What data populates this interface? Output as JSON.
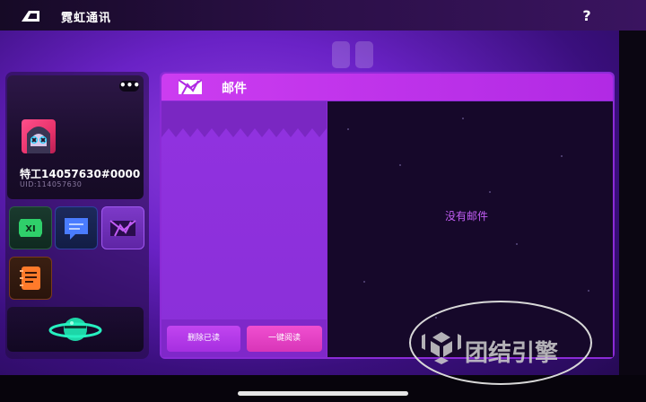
{
  "app": {
    "title": "霓虹通讯",
    "help_label": "?"
  },
  "profile": {
    "more_label": "•••",
    "name": "特工14057630#0000",
    "uid": "UID:114057630"
  },
  "mail": {
    "title": "邮件",
    "empty_message": "没有邮件",
    "delete_read_label": "删除已读",
    "read_all_label": "一键阅读"
  },
  "watermark": {
    "text": "团结引擎"
  },
  "icons": {
    "logo": "back-logo-icon",
    "help": "question-icon",
    "tile1": "x1-badge-icon",
    "tile2": "chat-bubble-icon",
    "tile3": "mail-icon",
    "tile4": "notebook-icon",
    "planet": "planet-icon"
  },
  "colors": {
    "accent": "#cc3cf0",
    "empty_text": "#c35ef5",
    "read_all": "#f04fd0",
    "delete_read": "#b03be8",
    "content_bg": "#16082a"
  }
}
